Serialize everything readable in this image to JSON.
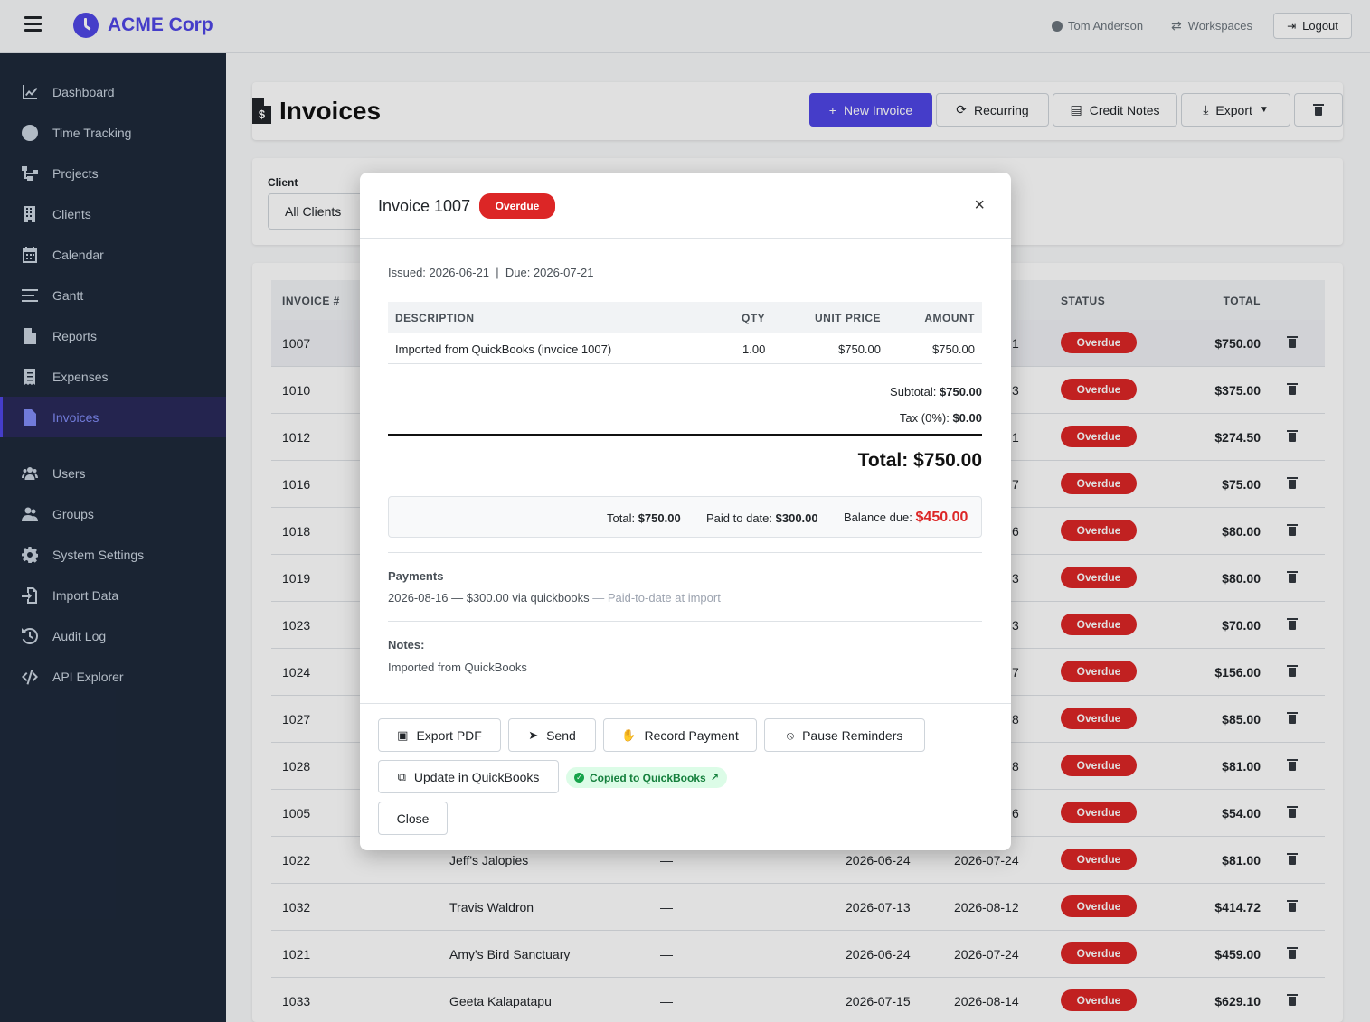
{
  "app": {
    "brand": "ACME Corp",
    "user": "Tom Anderson",
    "workspaces": "Workspaces",
    "logout": "Logout"
  },
  "sidebar": {
    "items": [
      {
        "label": "Dashboard",
        "icon": "chart-line-icon"
      },
      {
        "label": "Time Tracking",
        "icon": "clock-icon"
      },
      {
        "label": "Projects",
        "icon": "project-diagram-icon"
      },
      {
        "label": "Clients",
        "icon": "building-icon"
      },
      {
        "label": "Calendar",
        "icon": "calendar-icon"
      },
      {
        "label": "Gantt",
        "icon": "gantt-bars-icon"
      },
      {
        "label": "Reports",
        "icon": "file-report-icon"
      },
      {
        "label": "Expenses",
        "icon": "receipt-icon"
      },
      {
        "label": "Invoices",
        "icon": "invoice-dollar-icon"
      },
      {
        "label": "Users",
        "icon": "users-icon"
      },
      {
        "label": "Groups",
        "icon": "user-group-icon"
      },
      {
        "label": "System Settings",
        "icon": "gear-icon"
      },
      {
        "label": "Import Data",
        "icon": "file-import-icon"
      },
      {
        "label": "Audit Log",
        "icon": "history-icon"
      },
      {
        "label": "API Explorer",
        "icon": "code-icon"
      }
    ]
  },
  "page": {
    "title": "Invoices",
    "buttons": {
      "new_invoice": "New Invoice",
      "recurring": "Recurring",
      "credit_notes": "Credit Notes",
      "export": "Export"
    }
  },
  "filter": {
    "client_label": "Client",
    "client_value": "All Clients"
  },
  "table": {
    "headers": {
      "invoice": "INVOICE #",
      "status": "STATUS",
      "total": "TOTAL"
    },
    "rows": [
      {
        "num": "1007",
        "client": "",
        "project": "",
        "issued": "",
        "due": "",
        "due_tail": "1",
        "status": "Overdue",
        "total": "$750.00"
      },
      {
        "num": "1010",
        "client": "",
        "project": "",
        "issued": "",
        "due": "",
        "due_tail": "3",
        "status": "Overdue",
        "total": "$375.00"
      },
      {
        "num": "1012",
        "client": "",
        "project": "",
        "issued": "",
        "due": "",
        "due_tail": "1",
        "status": "Overdue",
        "total": "$274.50"
      },
      {
        "num": "1016",
        "client": "",
        "project": "",
        "issued": "",
        "due": "",
        "due_tail": "7",
        "status": "Overdue",
        "total": "$75.00"
      },
      {
        "num": "1018",
        "client": "",
        "project": "",
        "issued": "",
        "due": "",
        "due_tail": "6",
        "status": "Overdue",
        "total": "$80.00"
      },
      {
        "num": "1019",
        "client": "",
        "project": "",
        "issued": "",
        "due": "",
        "due_tail": "3",
        "status": "Overdue",
        "total": "$80.00"
      },
      {
        "num": "1023",
        "client": "",
        "project": "",
        "issued": "",
        "due": "",
        "due_tail": "3",
        "status": "Overdue",
        "total": "$70.00"
      },
      {
        "num": "1024",
        "client": "",
        "project": "",
        "issued": "",
        "due": "",
        "due_tail": "7",
        "status": "Overdue",
        "total": "$156.00"
      },
      {
        "num": "1027",
        "client": "",
        "project": "",
        "issued": "",
        "due": "",
        "due_tail": "8",
        "status": "Overdue",
        "total": "$85.00"
      },
      {
        "num": "1028",
        "client": "",
        "project": "",
        "issued": "",
        "due": "",
        "due_tail": "8",
        "status": "Overdue",
        "total": "$81.00"
      },
      {
        "num": "1005",
        "client": "",
        "project": "",
        "issued": "",
        "due": "",
        "due_tail": "6",
        "status": "Overdue",
        "total": "$54.00"
      },
      {
        "num": "1022",
        "client": "Jeff's Jalopies",
        "project": "—",
        "issued": "2026-06-24",
        "due": "2026-07-24",
        "due_tail": "",
        "status": "Overdue",
        "total": "$81.00"
      },
      {
        "num": "1032",
        "client": "Travis Waldron",
        "project": "—",
        "issued": "2026-07-13",
        "due": "2026-08-12",
        "due_tail": "",
        "status": "Overdue",
        "total": "$414.72"
      },
      {
        "num": "1021",
        "client": "Amy's Bird Sanctuary",
        "project": "—",
        "issued": "2026-06-24",
        "due": "2026-07-24",
        "due_tail": "",
        "status": "Overdue",
        "total": "$459.00"
      },
      {
        "num": "1033",
        "client": "Geeta Kalapatapu",
        "project": "—",
        "issued": "2026-07-15",
        "due": "2026-08-14",
        "due_tail": "",
        "status": "Overdue",
        "total": "$629.10"
      }
    ]
  },
  "modal": {
    "title": "Invoice 1007",
    "status": "Overdue",
    "close_x": "×",
    "issued_line": "Issued: 2026-06-21  |  Due: 2026-07-21",
    "items_headers": {
      "description": "DESCRIPTION",
      "qty": "QTY",
      "unit_price": "UNIT PRICE",
      "amount": "AMOUNT"
    },
    "items": [
      {
        "description": "Imported from QuickBooks (invoice 1007)",
        "qty": "1.00",
        "unit_price": "$750.00",
        "amount": "$750.00"
      }
    ],
    "subtotal_label": "Subtotal:",
    "subtotal_value": "$750.00",
    "tax_label": "Tax (0%):",
    "tax_value": "$0.00",
    "grand_total": "Total: $750.00",
    "balance": {
      "total_label": "Total:",
      "total_value": "$750.00",
      "paid_label": "Paid to date:",
      "paid_value": "$300.00",
      "due_label": "Balance due:",
      "due_value": "$450.00"
    },
    "payments_title": "Payments",
    "payment_line": "2026-08-16 — $300.00 via quickbooks",
    "payment_note": " — Paid-to-date at import",
    "notes_title": "Notes:",
    "notes_body": "Imported from QuickBooks",
    "buttons": {
      "export_pdf": "Export PDF",
      "send": "Send",
      "record_payment": "Record Payment",
      "pause_reminders": "Pause Reminders",
      "update_qb": "Update in QuickBooks",
      "close": "Close"
    },
    "qb_badge": "Copied to QuickBooks"
  },
  "colors": {
    "accent": "#4f46e5",
    "sidebar_bg": "#1e293b",
    "overdue": "#dc2626",
    "success": "#15803d"
  }
}
